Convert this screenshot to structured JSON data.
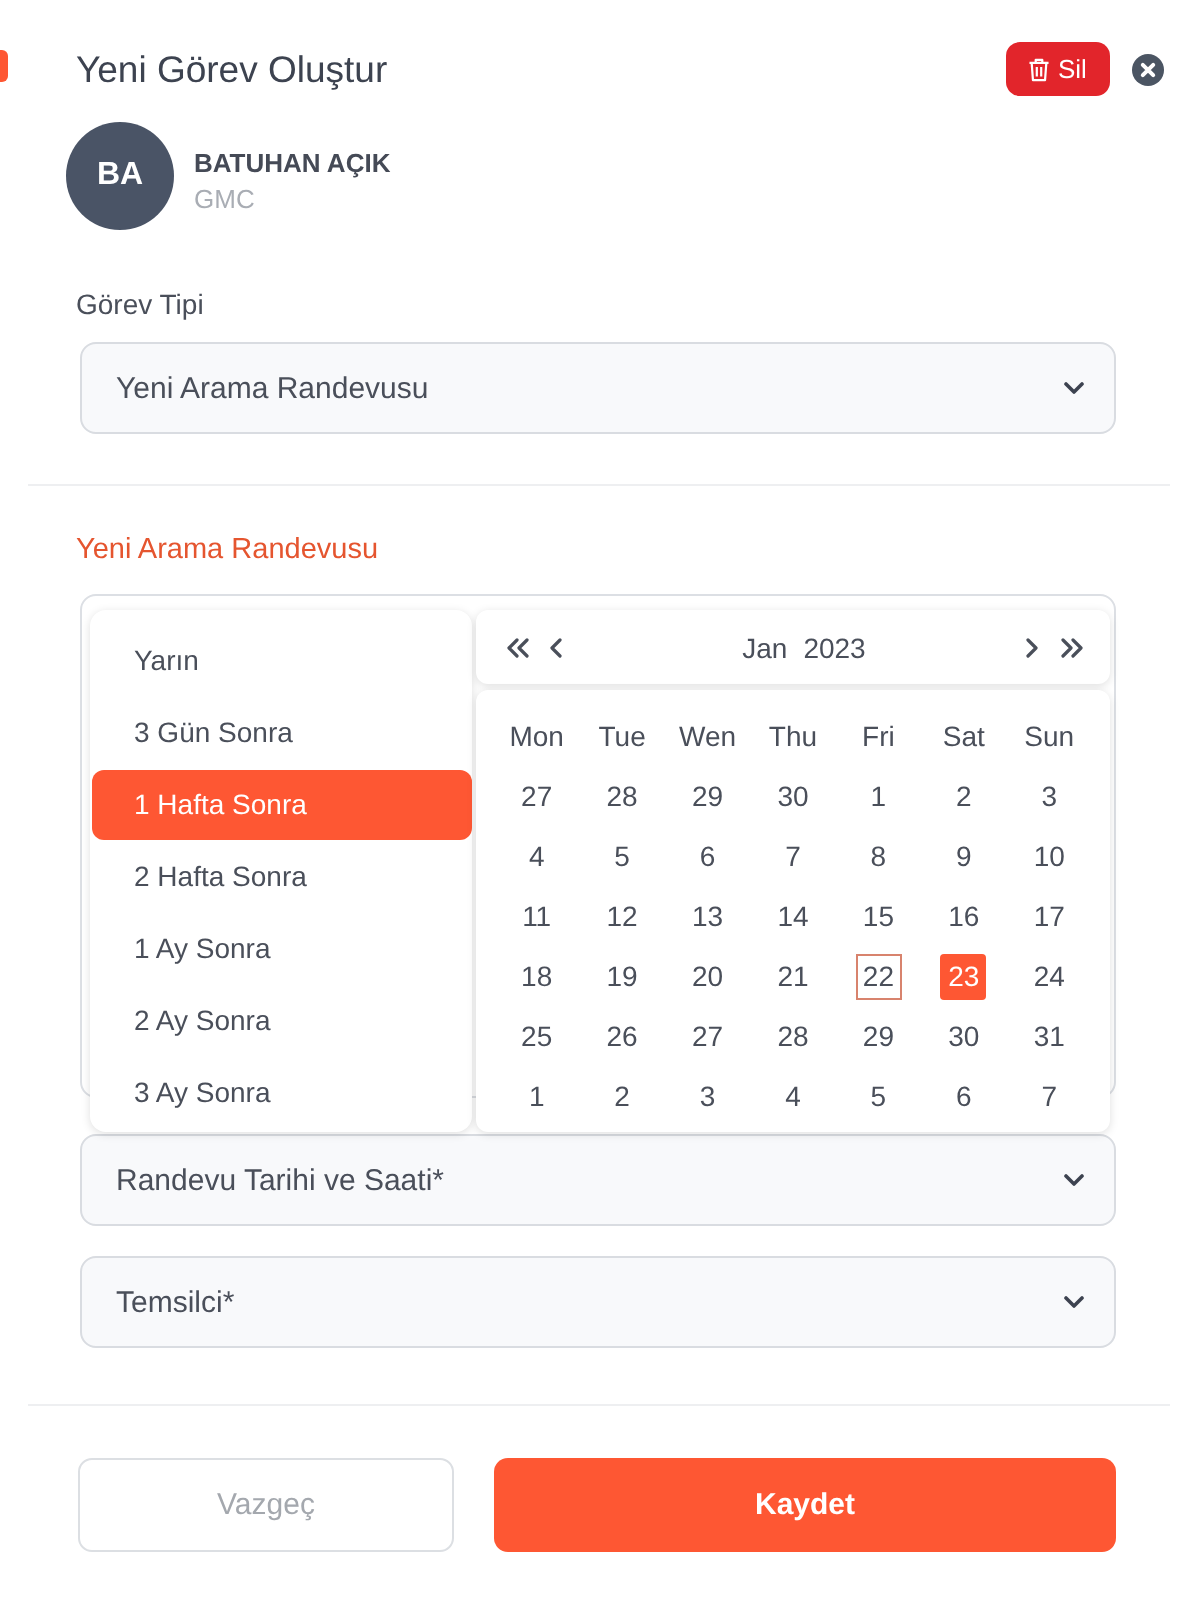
{
  "header": {
    "title": "Yeni Görev Oluştur",
    "delete_label": "Sil"
  },
  "user": {
    "initials": "BA",
    "name": "BATUHAN AÇIK",
    "company": "GMC"
  },
  "task_type": {
    "label": "Görev Tipi",
    "value": "Yeni Arama Randevusu"
  },
  "section_title": "Yeni Arama Randevusu",
  "quick_dates": [
    {
      "label": "Yarın",
      "selected": false
    },
    {
      "label": "3 Gün Sonra",
      "selected": false
    },
    {
      "label": "1 Hafta Sonra",
      "selected": true
    },
    {
      "label": "2 Hafta Sonra",
      "selected": false
    },
    {
      "label": "1 Ay Sonra",
      "selected": false
    },
    {
      "label": "2 Ay Sonra",
      "selected": false
    },
    {
      "label": "3 Ay Sonra",
      "selected": false
    }
  ],
  "calendar": {
    "month": "Jan",
    "year": "2023",
    "weekdays": [
      "Mon",
      "Tue",
      "Wen",
      "Thu",
      "Fri",
      "Sat",
      "Sun"
    ],
    "weeks": [
      [
        {
          "day": "27",
          "today": false,
          "selected": false
        },
        {
          "day": "28",
          "today": false,
          "selected": false
        },
        {
          "day": "29",
          "today": false,
          "selected": false
        },
        {
          "day": "30",
          "today": false,
          "selected": false
        },
        {
          "day": "1",
          "today": false,
          "selected": false
        },
        {
          "day": "2",
          "today": false,
          "selected": false
        },
        {
          "day": "3",
          "today": false,
          "selected": false
        }
      ],
      [
        {
          "day": "4",
          "today": false,
          "selected": false
        },
        {
          "day": "5",
          "today": false,
          "selected": false
        },
        {
          "day": "6",
          "today": false,
          "selected": false
        },
        {
          "day": "7",
          "today": false,
          "selected": false
        },
        {
          "day": "8",
          "today": false,
          "selected": false
        },
        {
          "day": "9",
          "today": false,
          "selected": false
        },
        {
          "day": "10",
          "today": false,
          "selected": false
        }
      ],
      [
        {
          "day": "11",
          "today": false,
          "selected": false
        },
        {
          "day": "12",
          "today": false,
          "selected": false
        },
        {
          "day": "13",
          "today": false,
          "selected": false
        },
        {
          "day": "14",
          "today": false,
          "selected": false
        },
        {
          "day": "15",
          "today": false,
          "selected": false
        },
        {
          "day": "16",
          "today": false,
          "selected": false
        },
        {
          "day": "17",
          "today": false,
          "selected": false
        }
      ],
      [
        {
          "day": "18",
          "today": false,
          "selected": false
        },
        {
          "day": "19",
          "today": false,
          "selected": false
        },
        {
          "day": "20",
          "today": false,
          "selected": false
        },
        {
          "day": "21",
          "today": false,
          "selected": false
        },
        {
          "day": "22",
          "today": true,
          "selected": false
        },
        {
          "day": "23",
          "today": false,
          "selected": true
        },
        {
          "day": "24",
          "today": false,
          "selected": false
        }
      ],
      [
        {
          "day": "25",
          "today": false,
          "selected": false
        },
        {
          "day": "26",
          "today": false,
          "selected": false
        },
        {
          "day": "27",
          "today": false,
          "selected": false
        },
        {
          "day": "28",
          "today": false,
          "selected": false
        },
        {
          "day": "29",
          "today": false,
          "selected": false
        },
        {
          "day": "30",
          "today": false,
          "selected": false
        },
        {
          "day": "31",
          "today": false,
          "selected": false
        }
      ],
      [
        {
          "day": "1",
          "today": false,
          "selected": false
        },
        {
          "day": "2",
          "today": false,
          "selected": false
        },
        {
          "day": "3",
          "today": false,
          "selected": false
        },
        {
          "day": "4",
          "today": false,
          "selected": false
        },
        {
          "day": "5",
          "today": false,
          "selected": false
        },
        {
          "day": "6",
          "today": false,
          "selected": false
        },
        {
          "day": "7",
          "today": false,
          "selected": false
        }
      ]
    ]
  },
  "fields": [
    {
      "placeholder": "Randevu Tarihi ve Saati*"
    },
    {
      "placeholder": "Temsilci*"
    }
  ],
  "buttons": [
    {
      "label": "Vazgeç",
      "kind": "secondary"
    },
    {
      "label": "Kaydet",
      "kind": "primary"
    }
  ]
}
